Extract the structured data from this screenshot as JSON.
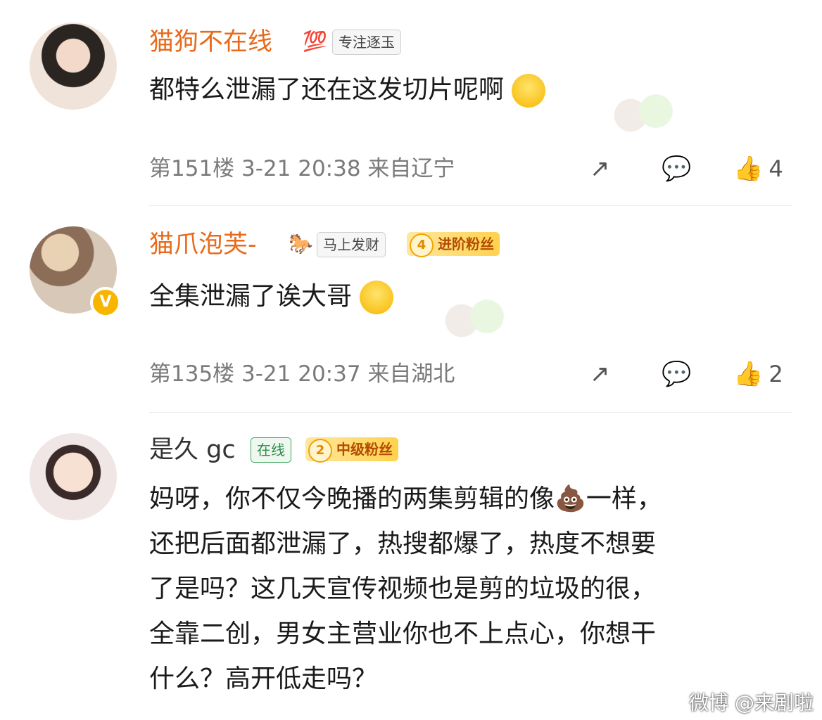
{
  "comments": [
    {
      "username": "猫狗不在线",
      "badge_icon": "💯",
      "badge": "专注逐玉",
      "text": "都特么泄漏了还在这发切片呢啊",
      "emoji": "smile",
      "meta": "第151楼 3-21 20:38 来自辽宁",
      "likes": "4"
    },
    {
      "username": "猫爪泡芙-",
      "badge_icon": "horse",
      "badge": "马上发财",
      "fan_level": "4",
      "fan_label": "进阶粉丝",
      "verified": "V",
      "text": "全集泄漏了诶大哥",
      "emoji": "shocked",
      "meta": "第135楼 3-21 20:37 来自湖北",
      "likes": "2"
    },
    {
      "username": "是久 gc",
      "status": "在线",
      "fan_level": "2",
      "fan_label": "中级粉丝",
      "text_lines": [
        "妈呀，你不仅今晚播的两集剪辑的像💩一样，",
        "还把后面都泄漏了，热搜都爆了，热度不想要",
        "了是吗？这几天宣传视频也是剪的垃圾的很，",
        "全靠二创，男女主营业你也不上点心，你想干",
        "什么？高开低走吗？"
      ]
    }
  ],
  "watermark": "微博 @来剧啦",
  "colors": {
    "username": "#e86a1a",
    "meta": "#7a7a7a",
    "fan_badge": "#ffd24d"
  }
}
